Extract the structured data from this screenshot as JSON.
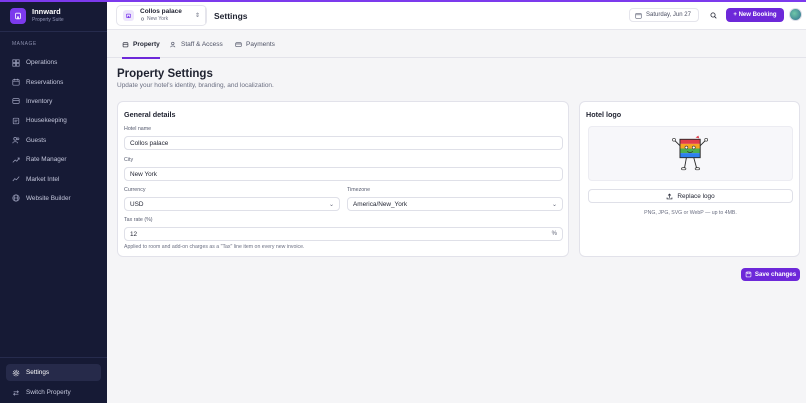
{
  "brand": {
    "name": "Innward",
    "subtitle": "Property Suite",
    "accent": "#7c3aed"
  },
  "sidebar": {
    "section_label": "MANAGE",
    "items": [
      {
        "label": "Operations",
        "icon": "grid-icon"
      },
      {
        "label": "Reservations",
        "icon": "calendar-icon"
      },
      {
        "label": "Inventory",
        "icon": "box-icon"
      },
      {
        "label": "Housekeeping",
        "icon": "broom-icon"
      },
      {
        "label": "Guests",
        "icon": "users-icon"
      },
      {
        "label": "Rate Manager",
        "icon": "trend-icon"
      },
      {
        "label": "Market Intel",
        "icon": "chart-icon"
      },
      {
        "label": "Website Builder",
        "icon": "globe-icon"
      }
    ],
    "bottom": {
      "settings": "Settings",
      "switch_property": "Switch Property"
    }
  },
  "header": {
    "property_name": "Collos palace",
    "property_city": "New York",
    "page_title": "Settings",
    "date": "Saturday, Jun 27",
    "new_booking": "+ New Booking"
  },
  "tabs": [
    {
      "label": "Property",
      "active": true
    },
    {
      "label": "Staff & Access",
      "active": false
    },
    {
      "label": "Payments",
      "active": false
    }
  ],
  "main": {
    "title": "Property Settings",
    "subtitle": "Update your hotel's identity, branding, and localization.",
    "general": {
      "title": "General details",
      "hotel_name_label": "Hotel name",
      "hotel_name_value": "Collos palace",
      "city_label": "City",
      "city_value": "New York",
      "currency_label": "Currency",
      "currency_value": "USD",
      "timezone_label": "Timezone",
      "timezone_value": "America/New_York",
      "tax_label": "Tax rate (%)",
      "tax_value": "12",
      "tax_suffix": "%",
      "tax_help": "Applied to room and add-on charges as a \"Tax\" line item on every new invoice."
    },
    "logo": {
      "title": "Hotel logo",
      "replace_label": "Replace logo",
      "hint": "PNG, JPG, SVG or WebP — up to 4MB."
    },
    "save_label": "Save changes"
  }
}
